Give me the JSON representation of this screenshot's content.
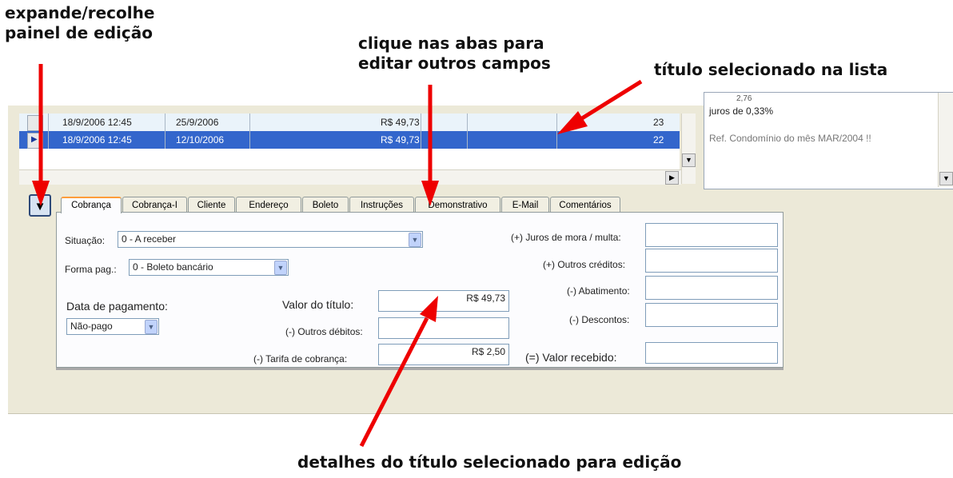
{
  "annotations": {
    "expand_line1": "expande/recolhe",
    "expand_line2": "painel de edição",
    "tabs_line1": "clique nas abas para",
    "tabs_line2": "editar outros campos",
    "selected": "título selecionado na lista",
    "details": "detalhes do título selecionado para edição"
  },
  "grid": {
    "rows": [
      {
        "emissao": "18/9/2006 12:45",
        "vencimento": "25/9/2006",
        "valor": "R$ 49,73",
        "num": "23"
      },
      {
        "emissao": "18/9/2006 12:45",
        "vencimento": "12/10/2006",
        "valor": "R$ 49,73",
        "num": "22"
      }
    ]
  },
  "memo": {
    "line1": "2,76",
    "line2": "juros de 0,33%",
    "line3": "Ref. Condomínio do mês MAR/2004 !!"
  },
  "expand_button": "▼",
  "tabs": [
    "Cobrança",
    "Cobrança-I",
    "Cliente",
    "Endereço",
    "Boleto",
    "Instruções",
    "Demonstrativo",
    "E-Mail",
    "Comentários"
  ],
  "form": {
    "situacao_label": "Situação:",
    "situacao_value": "0 - A receber",
    "forma_label": "Forma pag.:",
    "forma_value": "0 - Boleto bancário",
    "data_pag_label": "Data de pagamento:",
    "data_pag_value": "Não-pago",
    "valor_titulo_label": "Valor do título:",
    "valor_titulo_value": "R$ 49,73",
    "outros_debitos_label": "(-) Outros débitos:",
    "outros_debitos_value": "",
    "tarifa_label": "(-) Tarifa de cobrança:",
    "tarifa_value": "R$ 2,50",
    "juros_label": "(+) Juros de mora / multa:",
    "outros_creditos_label": "(+) Outros créditos:",
    "abatimento_label": "(-) Abatimento:",
    "descontos_label": "(-) Descontos:",
    "valor_recebido_label": "(=) Valor recebido:"
  },
  "colors": {
    "selection": "#3366cc",
    "arrow": "#ee0000",
    "active_tab": "#ff9d3a"
  }
}
